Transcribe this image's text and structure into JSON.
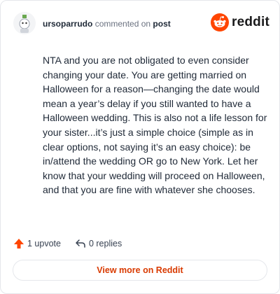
{
  "header": {
    "username": "ursoparrudo",
    "action_text": "commented on",
    "post_link": "post",
    "brand_text": "reddit"
  },
  "comment": {
    "text": "NTA and you are not obligated to even consider changing your date. You are getting married on Halloween for a reason—changing the date would mean a year’s delay if you still wanted to have a Halloween wedding. This is also not a life lesson for your sister...it’s just a simple choice (simple as in clear options, not saying it’s an easy choice): be in/attend the wedding OR go to New York. Let her know that your wedding will proceed on Halloween, and that you are fine with whatever she chooses."
  },
  "actions": {
    "upvote_label": "1 upvote",
    "replies_label": "0 replies"
  },
  "footer": {
    "view_more_label": "View more on Reddit"
  },
  "icons": {
    "avatar": "snoo-avatar-icon",
    "brand": "reddit-logo-icon",
    "upvote": "upvote-arrow-icon",
    "reply": "reply-arrow-icon"
  },
  "colors": {
    "accent": "#d93a00",
    "brand_orange": "#ff4500",
    "text": "#1f2937",
    "muted": "#6b7280"
  }
}
